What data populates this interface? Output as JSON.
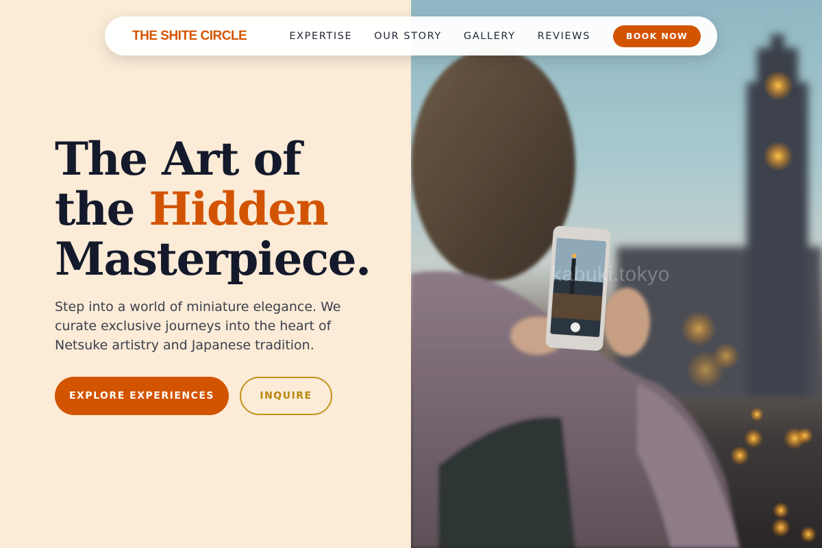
{
  "nav": {
    "brand": "THE SHITE CIRCLE",
    "links": [
      "EXPERTISE",
      "OUR STORY",
      "GALLERY",
      "REVIEWS"
    ],
    "cta": "BOOK NOW"
  },
  "hero": {
    "title_line1": "The Art of",
    "title_line2_prefix": "the ",
    "title_line2_accent": "Hidden",
    "title_line3": "Masterpiece.",
    "description": "Step into a world of miniature elegance. We curate exclusive journeys into the heart of Netsuke artistry and Japanese tradition.",
    "primary_button": "EXPLORE EXPERIENCES",
    "secondary_button": "INQUIRE"
  },
  "image": {
    "watermark": "kabuki.tokyo",
    "description_icon": "photo-of-person-photographing-clock-tower"
  },
  "colors": {
    "accent": "#d35400",
    "gold": "#c4921a",
    "background": "#fbebd7",
    "text_dark": "#141a2b"
  }
}
